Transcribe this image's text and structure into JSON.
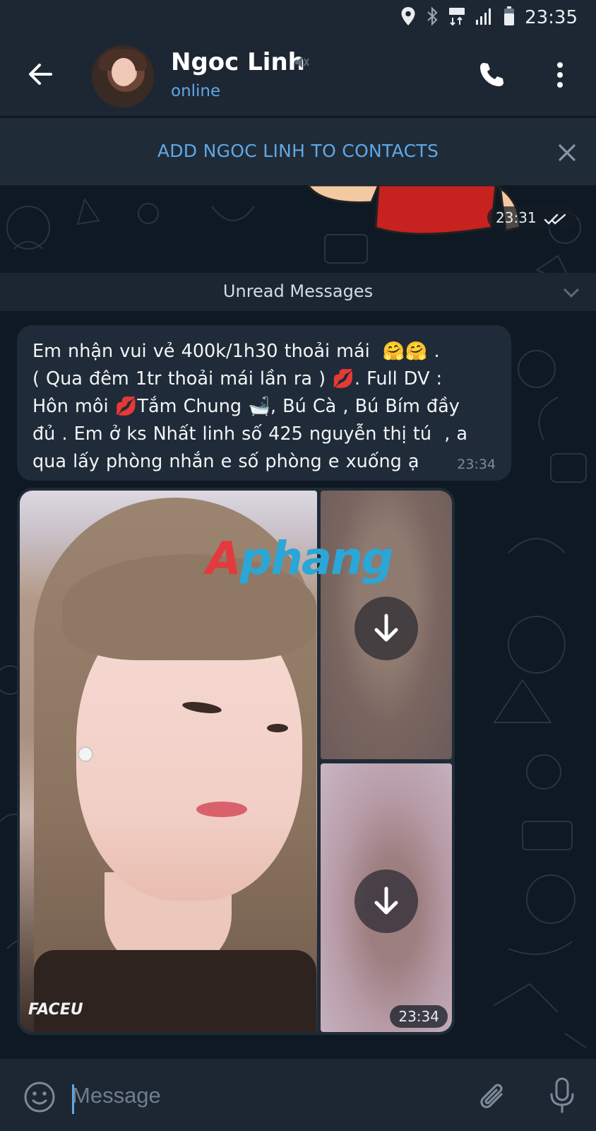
{
  "status_bar": {
    "time": "23:35",
    "icons": [
      "location-icon",
      "bluetooth-icon",
      "lte-icon",
      "signal-icon",
      "battery-icon"
    ]
  },
  "header": {
    "contact_name": "Ngoc Linh",
    "status": "online",
    "muted": true,
    "accent_color": "#5fa8e6"
  },
  "add_contact_bar": {
    "label": "ADD NGOC LINH TO CONTACTS"
  },
  "chat": {
    "previous_message": {
      "time": "23:31",
      "read_state": "double-check"
    },
    "unread_divider": "Unread Messages",
    "text_message": {
      "text": "Em nhận vui vẻ 400k/1h30 thoải mái  🤗🤗 .\n( Qua đêm 1tr thoải mái lần ra ) 💋. Full DV :\nHôn môi 💋Tắm Chung 🛁, Bú Cà , Bú Bím đầy\nđủ . Em ở ks Nhất linh số 425 nguyễn thị tú  , a\nqua lấy phòng nhắn e số phòng e xuống ạ",
      "time": "23:34"
    },
    "album": {
      "time": "23:34",
      "watermark_part1": "A",
      "watermark_part2": "phang",
      "photo_watermark": "FACEU",
      "photo_count": 3
    }
  },
  "composer": {
    "placeholder": "Message"
  },
  "colors": {
    "background": "#0e1621",
    "header": "#1d2733",
    "bubble": "#1f2b38"
  }
}
